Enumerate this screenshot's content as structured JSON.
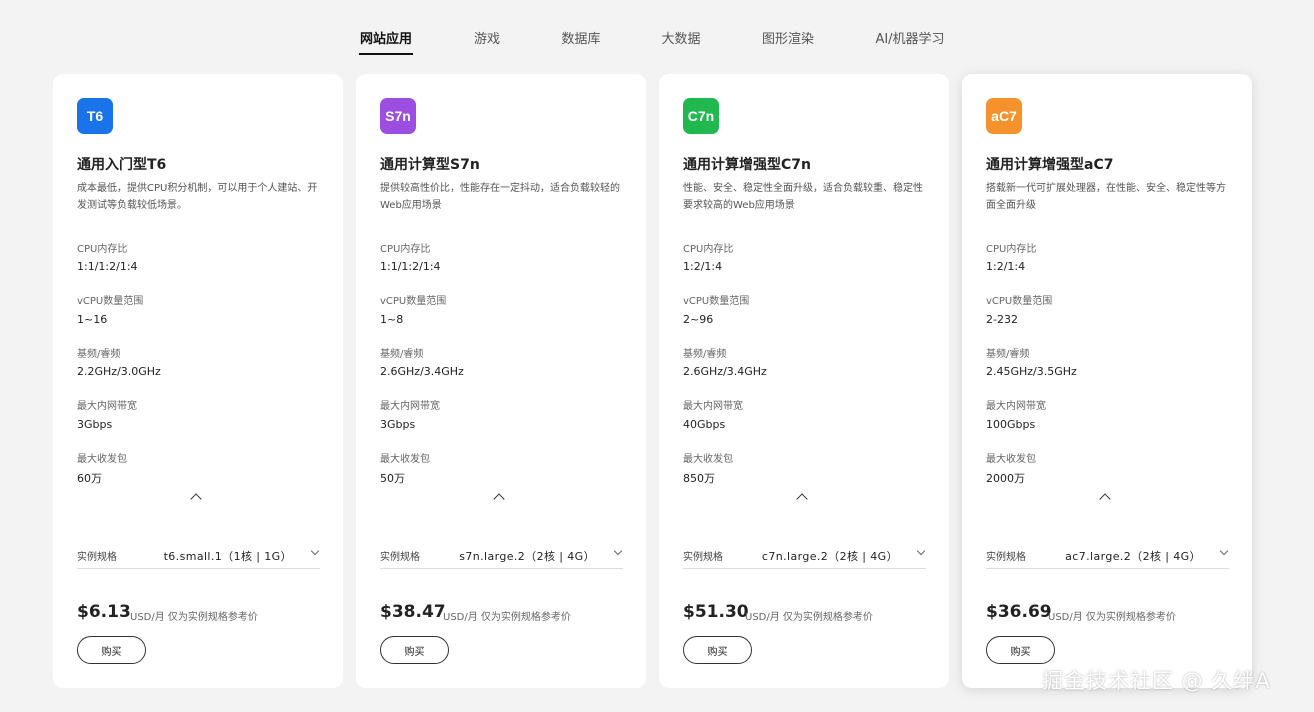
{
  "tabs": [
    "网站应用",
    "游戏",
    "数据库",
    "大数据",
    "图形渲染",
    "AI/机器学习"
  ],
  "spec_labels": {
    "cpu_ratio": "CPU内存比",
    "vcpu_range": "vCPU数量范围",
    "freq": "基频/睿频",
    "bandwidth": "最大内网带宽",
    "pps": "最大收发包"
  },
  "cards": [
    {
      "badge": "T6",
      "badge_color": "#1a73e8",
      "title": "通用入门型T6",
      "desc": "成本最低，提供CPU积分机制，可以用于个人建站、开发测试等负载较低场景。",
      "cpu_ratio": "1:1/1:2/1:4",
      "vcpu_range": "1~16",
      "freq": "2.2GHz/3.0GHz",
      "bandwidth": "3Gbps",
      "pps": "60万",
      "spec_label": "实例规格",
      "spec_value": "t6.small.1（1核 | 1G）",
      "price": "$6.13",
      "price_unit": "USD/月  仅为实例规格参考价",
      "buy": "购买"
    },
    {
      "badge": "S7n",
      "badge_color": "#9b4ee0",
      "title": "通用计算型S7n",
      "desc": "提供较高性价比，性能存在一定抖动，适合负载较轻的Web应用场景",
      "cpu_ratio": "1:1/1:2/1:4",
      "vcpu_range": "1~8",
      "freq": "2.6GHz/3.4GHz",
      "bandwidth": "3Gbps",
      "pps": "50万",
      "spec_label": "实例规格",
      "spec_value": "s7n.large.2（2核 | 4G）",
      "price": "$38.47",
      "price_unit": "USD/月  仅为实例规格参考价",
      "buy": "购买"
    },
    {
      "badge": "C7n",
      "badge_color": "#22b850",
      "title": "通用计算增强型C7n",
      "desc": "性能、安全、稳定性全面升级，适合负载较重、稳定性要求较高的Web应用场景",
      "cpu_ratio": "1:2/1:4",
      "vcpu_range": "2~96",
      "freq": "2.6GHz/3.4GHz",
      "bandwidth": "40Gbps",
      "pps": "850万",
      "spec_label": "实例规格",
      "spec_value": "c7n.large.2（2核 | 4G）",
      "price": "$51.30",
      "price_unit": "USD/月  仅为实例规格参考价",
      "buy": "购买"
    },
    {
      "badge": "aC7",
      "badge_color": "#f5922b",
      "title": "通用计算增强型aC7",
      "desc": "搭载新一代可扩展处理器，在性能、安全、稳定性等方面全面升级",
      "cpu_ratio": "1:2/1:4",
      "vcpu_range": "2-232",
      "freq": "2.45GHz/3.5GHz",
      "bandwidth": "100Gbps",
      "pps": "2000万",
      "spec_label": "实例规格",
      "spec_value": "ac7.large.2（2核 | 4G）",
      "price": "$36.69",
      "price_unit": "USD/月  仅为实例规格参考价",
      "buy": "购买"
    }
  ],
  "watermark": "掘金技术社区 @ 久绊A"
}
